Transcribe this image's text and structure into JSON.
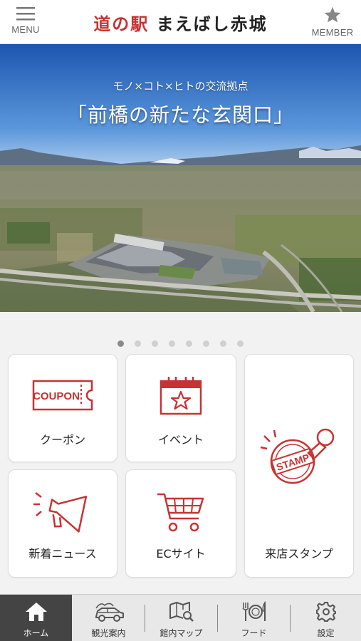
{
  "header": {
    "menu_label": "MENU",
    "title_part1": "道の駅",
    "title_part2": "まえばし赤城",
    "member_label": "MEMBER"
  },
  "hero": {
    "subtitle": "モノ×コト×ヒトの交流拠点",
    "main_text": "「前橋の新たな玄関口」",
    "slide_count": 8,
    "active_slide": 1
  },
  "tiles": {
    "coupon": {
      "label": "クーポン",
      "icon_text": "COUPON"
    },
    "event": {
      "label": "イベント"
    },
    "stamp": {
      "label": "来店スタンプ",
      "icon_text": "STAMP"
    },
    "news": {
      "label": "新着ニュース"
    },
    "ec": {
      "label": "ECサイト"
    }
  },
  "tabbar": {
    "home": "ホーム",
    "sightseeing": "観光案内",
    "map": "館内マップ",
    "food": "フード",
    "settings": "設定"
  },
  "colors": {
    "accent": "#c83232",
    "tab_active_bg": "#444444",
    "tab_bar_bg": "#e8e8e8"
  }
}
